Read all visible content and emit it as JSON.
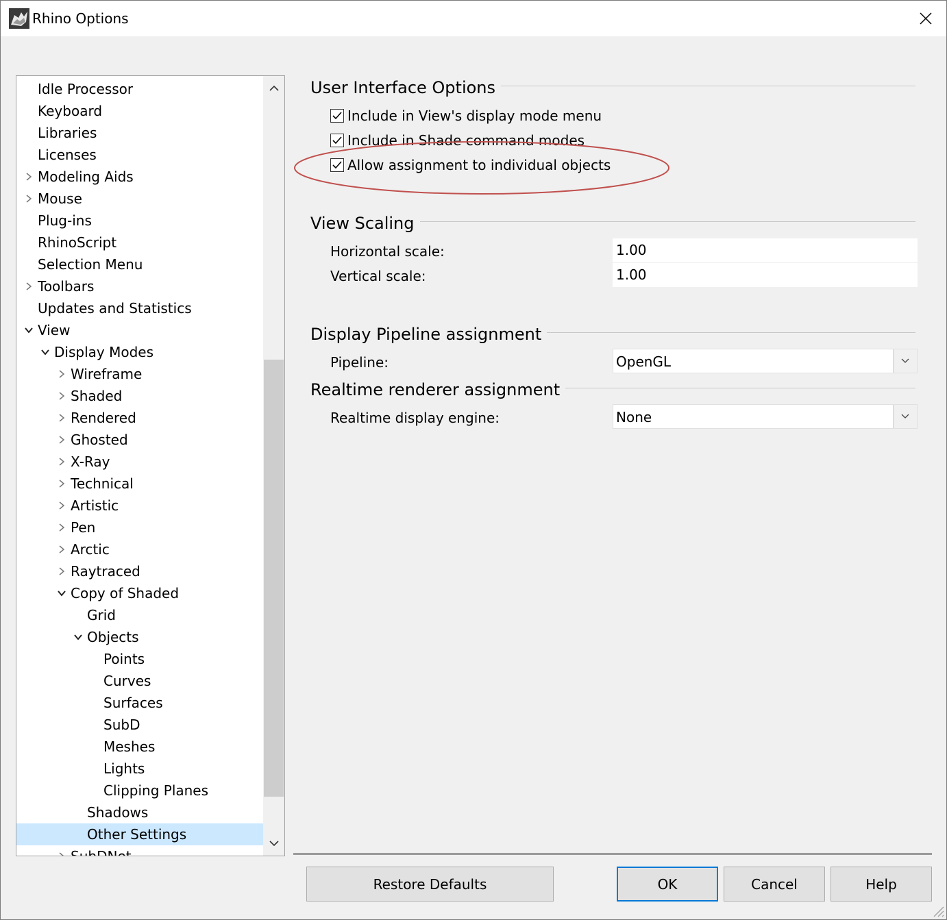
{
  "window": {
    "title": "Rhino Options",
    "close_icon": "close-icon",
    "app_icon": "rhino-app-icon"
  },
  "tree": {
    "items": [
      {
        "label": "Idle Processor",
        "level": 0,
        "expander": "none"
      },
      {
        "label": "Keyboard",
        "level": 0,
        "expander": "none"
      },
      {
        "label": "Libraries",
        "level": 0,
        "expander": "none"
      },
      {
        "label": "Licenses",
        "level": 0,
        "expander": "none"
      },
      {
        "label": "Modeling Aids",
        "level": 0,
        "expander": "collapsed"
      },
      {
        "label": "Mouse",
        "level": 0,
        "expander": "collapsed"
      },
      {
        "label": "Plug-ins",
        "level": 0,
        "expander": "none"
      },
      {
        "label": "RhinoScript",
        "level": 0,
        "expander": "none"
      },
      {
        "label": "Selection Menu",
        "level": 0,
        "expander": "none"
      },
      {
        "label": "Toolbars",
        "level": 0,
        "expander": "collapsed"
      },
      {
        "label": "Updates and Statistics",
        "level": 0,
        "expander": "none"
      },
      {
        "label": "View",
        "level": 0,
        "expander": "expanded"
      },
      {
        "label": "Display Modes",
        "level": 1,
        "expander": "expanded"
      },
      {
        "label": "Wireframe",
        "level": 2,
        "expander": "collapsed"
      },
      {
        "label": "Shaded",
        "level": 2,
        "expander": "collapsed"
      },
      {
        "label": "Rendered",
        "level": 2,
        "expander": "collapsed"
      },
      {
        "label": "Ghosted",
        "level": 2,
        "expander": "collapsed"
      },
      {
        "label": "X-Ray",
        "level": 2,
        "expander": "collapsed"
      },
      {
        "label": "Technical",
        "level": 2,
        "expander": "collapsed"
      },
      {
        "label": "Artistic",
        "level": 2,
        "expander": "collapsed"
      },
      {
        "label": "Pen",
        "level": 2,
        "expander": "collapsed"
      },
      {
        "label": "Arctic",
        "level": 2,
        "expander": "collapsed"
      },
      {
        "label": "Raytraced",
        "level": 2,
        "expander": "collapsed"
      },
      {
        "label": "Copy of Shaded",
        "level": 2,
        "expander": "expanded"
      },
      {
        "label": "Grid",
        "level": 3,
        "expander": "none"
      },
      {
        "label": "Objects",
        "level": 3,
        "expander": "expanded"
      },
      {
        "label": "Points",
        "level": 4,
        "expander": "none"
      },
      {
        "label": "Curves",
        "level": 4,
        "expander": "none"
      },
      {
        "label": "Surfaces",
        "level": 4,
        "expander": "none"
      },
      {
        "label": "SubD",
        "level": 4,
        "expander": "none"
      },
      {
        "label": "Meshes",
        "level": 4,
        "expander": "none"
      },
      {
        "label": "Lights",
        "level": 4,
        "expander": "none"
      },
      {
        "label": "Clipping Planes",
        "level": 4,
        "expander": "none"
      },
      {
        "label": "Shadows",
        "level": 3,
        "expander": "none"
      },
      {
        "label": "Other Settings",
        "level": 3,
        "expander": "none",
        "selected": true
      },
      {
        "label": "SubDNet",
        "level": 2,
        "expander": "collapsed"
      }
    ]
  },
  "ui_options": {
    "title": "User Interface Options",
    "checkboxes": [
      {
        "label": "Include in View's display mode menu",
        "checked": true
      },
      {
        "label": "Include in Shade command modes",
        "checked": true
      },
      {
        "label": "Allow assignment to individual objects",
        "checked": true
      }
    ]
  },
  "view_scaling": {
    "title": "View Scaling",
    "horizontal_label": "Horizontal scale:",
    "horizontal_value": "1.00",
    "vertical_label": "Vertical scale:",
    "vertical_value": "1.00"
  },
  "pipeline": {
    "title": "Display Pipeline assignment",
    "label": "Pipeline:",
    "value": "OpenGL"
  },
  "realtime": {
    "title": "Realtime renderer assignment",
    "label": "Realtime display engine:",
    "value": "None"
  },
  "buttons": {
    "restore": "Restore Defaults",
    "ok": "OK",
    "cancel": "Cancel",
    "help": "Help"
  },
  "colors": {
    "selection": "#cce8ff",
    "annotation": "#c0504d",
    "default_button_border": "#0078d7"
  }
}
